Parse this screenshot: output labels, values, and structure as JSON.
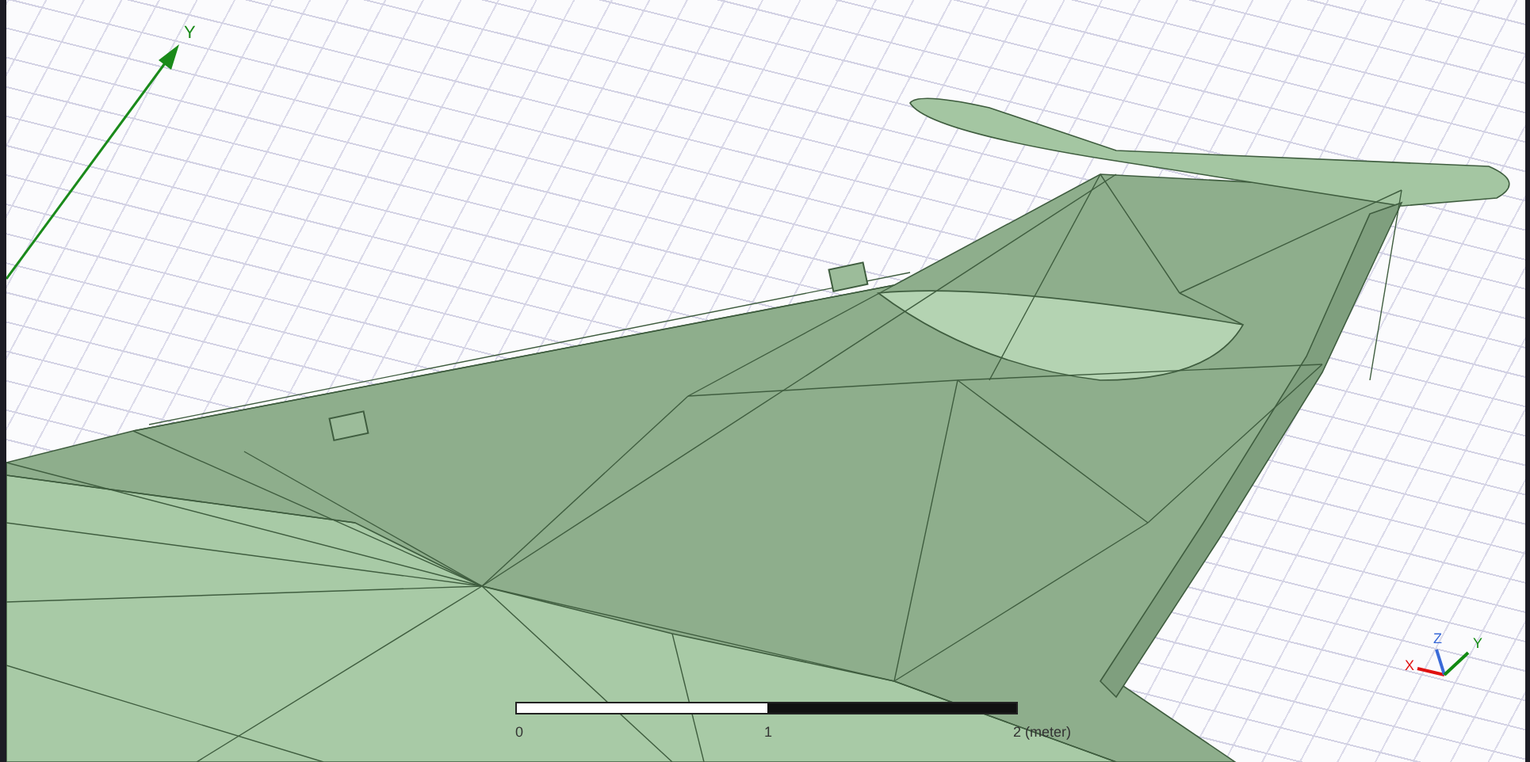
{
  "viewport": {
    "axis_label": "Y",
    "triad": {
      "x_label": "X",
      "y_label": "Y",
      "z_label": "Z"
    },
    "scale_bar": {
      "labels": [
        "0",
        "1",
        "2 (meter)"
      ]
    }
  }
}
